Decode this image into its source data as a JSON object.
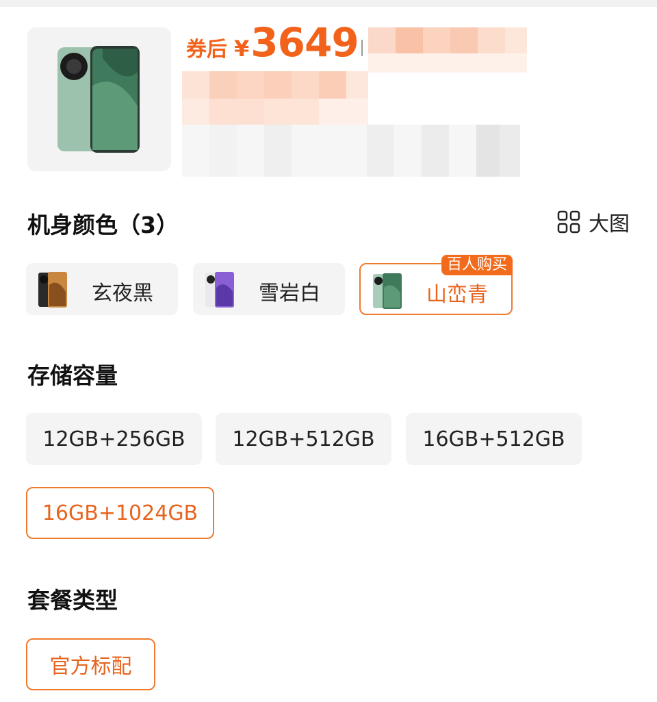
{
  "product": {
    "price_prefix": "券后",
    "price_currency": "¥",
    "price_value": "3649"
  },
  "colors": {
    "title": "机身颜色（3）",
    "big_view_label": "大图",
    "options": [
      {
        "label": "玄夜黑",
        "selected": false
      },
      {
        "label": "雪岩白",
        "selected": false
      },
      {
        "label": "山峦青",
        "selected": true,
        "badge": "百人购买"
      }
    ]
  },
  "storage": {
    "title": "存储容量",
    "options": [
      {
        "label": "12GB+256GB",
        "selected": false
      },
      {
        "label": "12GB+512GB",
        "selected": false
      },
      {
        "label": "16GB+512GB",
        "selected": false
      },
      {
        "label": "16GB+1024GB",
        "selected": true
      }
    ]
  },
  "package": {
    "title": "套餐类型",
    "options": [
      {
        "label": "官方标配",
        "selected": true
      }
    ]
  },
  "theme": {
    "accent": "#f2621a",
    "selected_border": "#f07a2e",
    "chip_bg": "#f4f4f4"
  }
}
